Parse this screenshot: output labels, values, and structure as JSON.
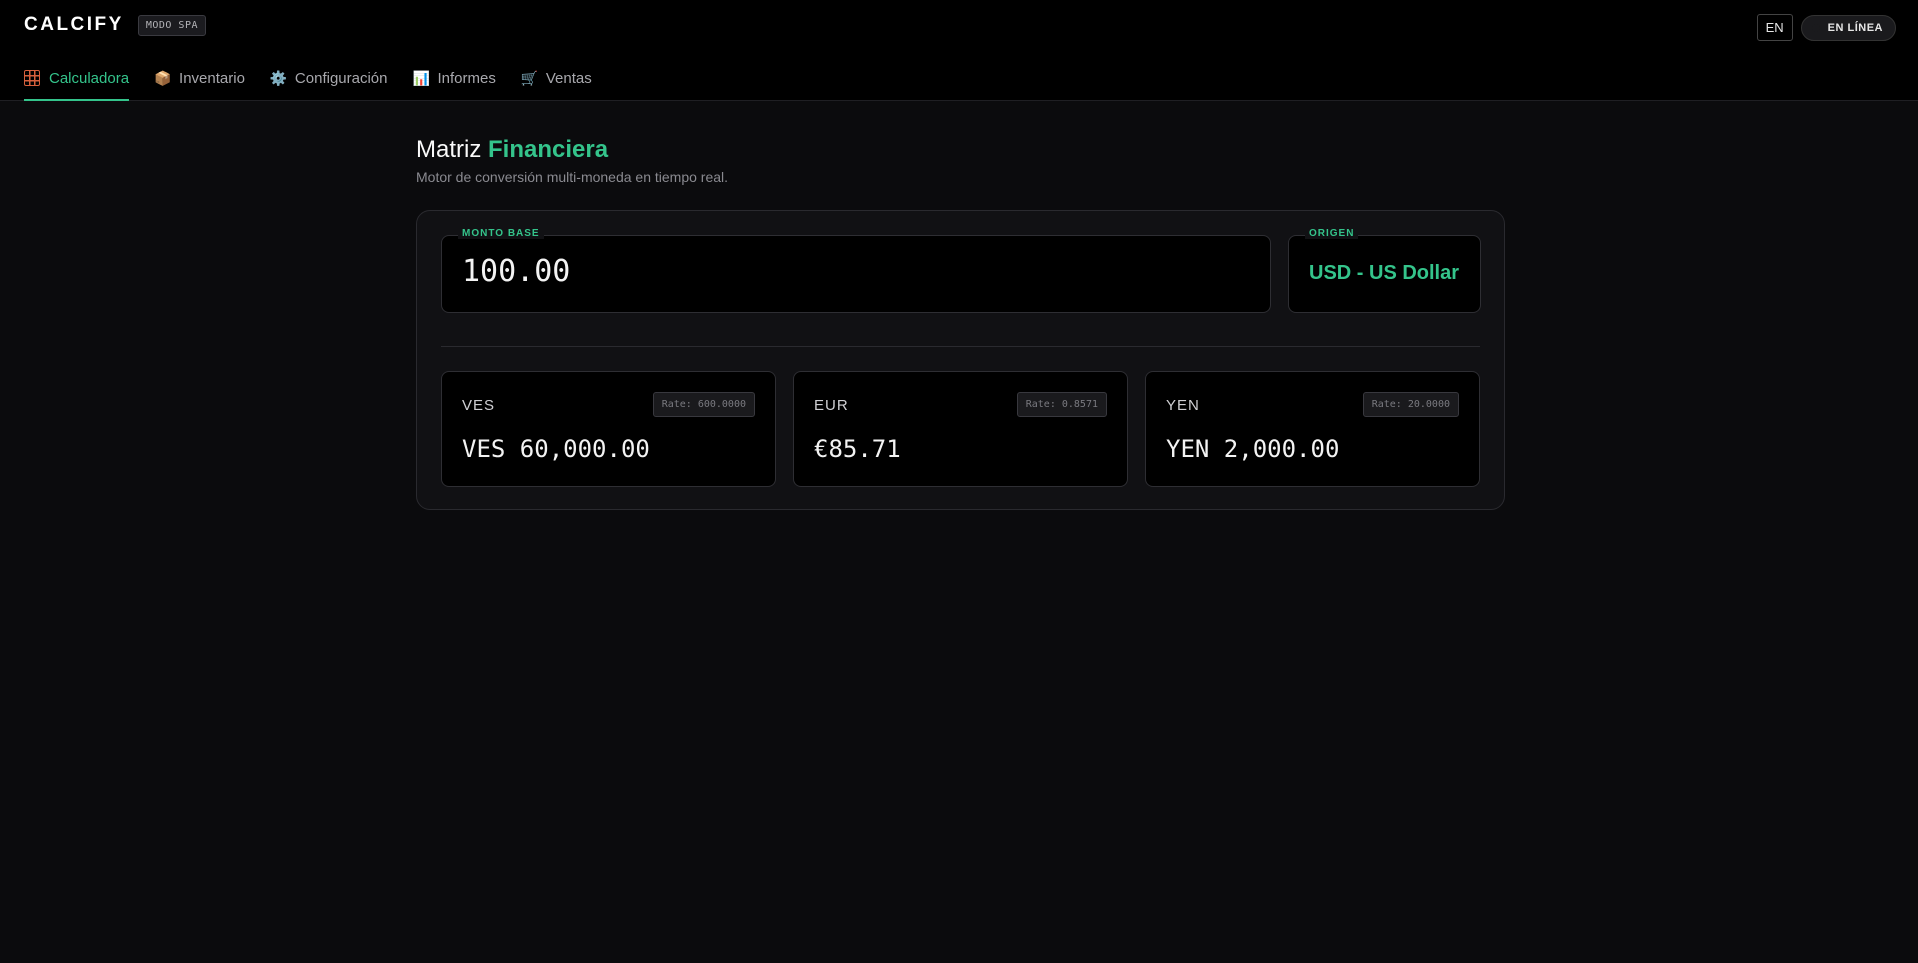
{
  "header": {
    "logo": "CALCIFY",
    "mode_badge": "MODO SPA",
    "language_button": "EN",
    "status": "EN LÍNEA"
  },
  "nav": {
    "items": [
      {
        "label": "Calculadora",
        "icon": "calculator-icon",
        "active": true
      },
      {
        "label": "Inventario",
        "icon": "package-icon",
        "active": false
      },
      {
        "label": "Configuración",
        "icon": "gear-icon",
        "active": false
      },
      {
        "label": "Informes",
        "icon": "bar-chart-icon",
        "active": false
      },
      {
        "label": "Ventas",
        "icon": "cart-icon",
        "active": false
      }
    ]
  },
  "page": {
    "title_plain": "Matriz",
    "title_accent": "Financiera",
    "subtitle": "Motor de conversión multi-moneda en tiempo real."
  },
  "converter": {
    "amount_label": "MONTO BASE",
    "amount_value": "100.00",
    "origin_label": "ORIGEN",
    "origin_value": "USD - US Dollar",
    "results": [
      {
        "code": "VES",
        "rate": "Rate: 600.0000",
        "value": "VES 60,000.00"
      },
      {
        "code": "EUR",
        "rate": "Rate: 0.8571",
        "value": "€85.71"
      },
      {
        "code": "YEN",
        "rate": "Rate: 20.0000",
        "value": "YEN 2,000.00"
      }
    ]
  },
  "colors": {
    "accent": "#34c48b",
    "background": "#0b0b0d",
    "topbar": "#000000"
  }
}
